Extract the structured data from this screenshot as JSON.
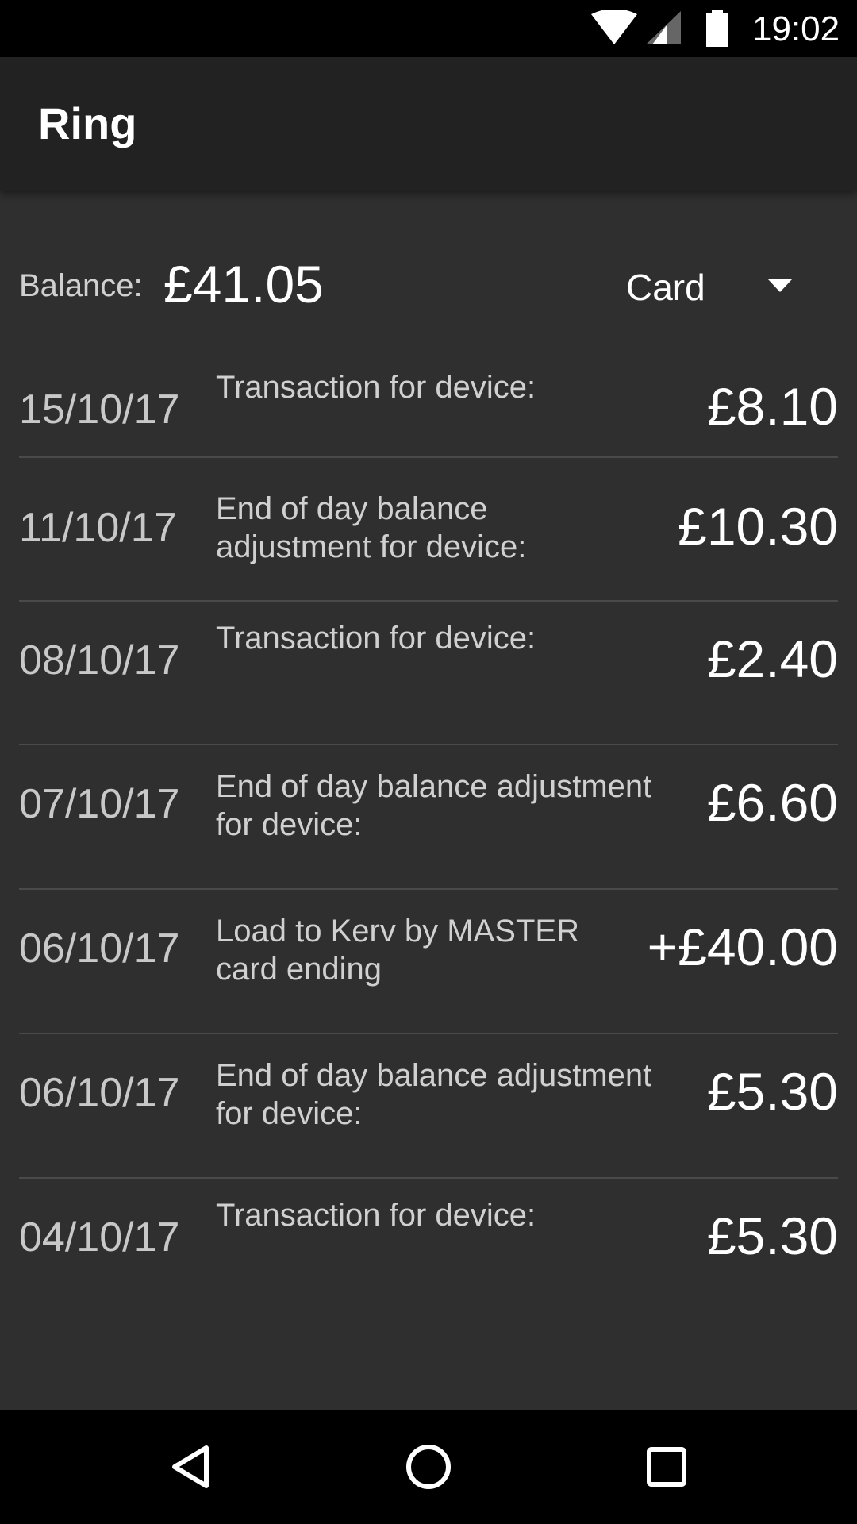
{
  "status_bar": {
    "time": "19:02",
    "icons": [
      "wifi-icon",
      "cellular-signal-icon",
      "battery-icon"
    ]
  },
  "toolbar": {
    "title": "Ring"
  },
  "balance": {
    "label": "Balance:",
    "value": "£41.05"
  },
  "card_selector": {
    "selected": "Card",
    "icon": "dropdown-arrow-icon"
  },
  "transactions": [
    {
      "date": "15/10/17",
      "description": "Transaction for device:",
      "amount": "£8.10"
    },
    {
      "date": "11/10/17",
      "description": "End of day balance\nadjustment for device:",
      "amount": "£10.30"
    },
    {
      "date": "08/10/17",
      "description": "Transaction for device:",
      "amount": "£2.40"
    },
    {
      "date": "07/10/17",
      "description": "End of day balance adjustment\nfor device:",
      "amount": "£6.60"
    },
    {
      "date": "06/10/17",
      "description": "Load to Kerv by MASTER\ncard ending",
      "amount": "+£40.00"
    },
    {
      "date": "06/10/17",
      "description": "End of day balance adjustment\nfor device:",
      "amount": "£5.30"
    },
    {
      "date": "04/10/17",
      "description": "Transaction for device:",
      "amount": "£5.30"
    }
  ],
  "nav_bar": {
    "buttons": [
      "back-icon",
      "home-icon",
      "recents-icon"
    ]
  },
  "colors": {
    "status_bar": "#000000",
    "toolbar": "#222222",
    "content_background": "#2f2f2f",
    "divider": "#4a4a4a",
    "primary_text": "#ffffff",
    "secondary_text": "#c8c8c8"
  }
}
